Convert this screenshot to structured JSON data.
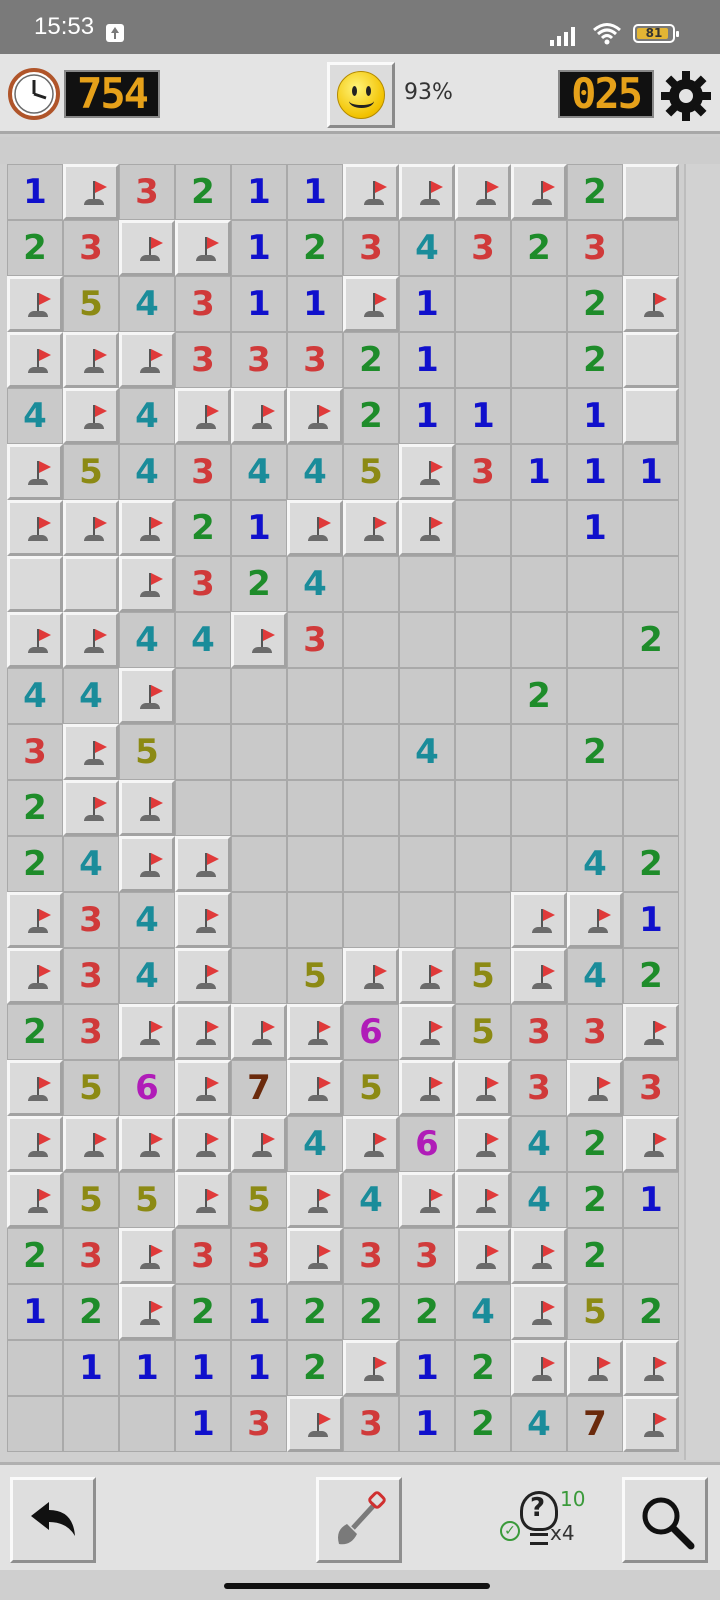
{
  "status_bar": {
    "time": "15:53",
    "battery": "81"
  },
  "header": {
    "timer": "754",
    "percent": "93%",
    "mines_left": "025"
  },
  "legend": {
    "F": "flag",
    "_": "empty opened",
    "R": "raised unopened"
  },
  "colors": {
    "1": "#1010cc",
    "2": "#1e8c2a",
    "3": "#d03a3a",
    "4": "#1a8c9a",
    "5": "#8c8a14",
    "6": "#b01cb8",
    "7": "#6a2a0c",
    "timer_digits": "#e6a11a",
    "flag": "#e03a3a"
  },
  "board": [
    [
      "1",
      "F",
      "3",
      "2",
      "1",
      "1",
      "F",
      "F",
      "F",
      "F",
      "2",
      "R"
    ],
    [
      "2",
      "3",
      "F",
      "F",
      "1",
      "2",
      "3",
      "4",
      "3",
      "2",
      "3",
      "_"
    ],
    [
      "F",
      "5",
      "4",
      "3",
      "1",
      "1",
      "F",
      "1",
      "_",
      "_",
      "2",
      "F"
    ],
    [
      "F",
      "F",
      "F",
      "3",
      "3",
      "3",
      "2",
      "1",
      "_",
      "_",
      "2",
      "R"
    ],
    [
      "4",
      "F",
      "4",
      "F",
      "F",
      "F",
      "2",
      "1",
      "1",
      "_",
      "1",
      "R"
    ],
    [
      "F",
      "5",
      "4",
      "3",
      "4",
      "4",
      "5",
      "F",
      "3",
      "1",
      "1",
      "1"
    ],
    [
      "F",
      "F",
      "F",
      "2",
      "1",
      "F",
      "F",
      "F",
      "_",
      "_",
      "1",
      "_"
    ],
    [
      "R",
      "R",
      "F",
      "3",
      "2",
      "4",
      "_",
      "_",
      "_",
      "_",
      "_",
      "_"
    ],
    [
      "F",
      "F",
      "4",
      "4",
      "F",
      "3",
      "_",
      "_",
      "_",
      "_",
      "_",
      "2"
    ],
    [
      "4",
      "4",
      "F",
      "_",
      "_",
      "_",
      "_",
      "_",
      "_",
      "2",
      "_",
      "_"
    ],
    [
      "3",
      "F",
      "5",
      "_",
      "_",
      "_",
      "_",
      "4",
      "_",
      "_",
      "2",
      "_"
    ],
    [
      "2",
      "F",
      "F",
      "_",
      "_",
      "_",
      "_",
      "_",
      "_",
      "_",
      "_",
      "_"
    ],
    [
      "2",
      "4",
      "F",
      "F",
      "_",
      "_",
      "_",
      "_",
      "_",
      "_",
      "4",
      "2"
    ],
    [
      "F",
      "3",
      "4",
      "F",
      "_",
      "_",
      "_",
      "_",
      "_",
      "F",
      "F",
      "1"
    ],
    [
      "F",
      "3",
      "4",
      "F",
      "_",
      "5",
      "F",
      "F",
      "5",
      "F",
      "4",
      "2"
    ],
    [
      "2",
      "3",
      "F",
      "F",
      "F",
      "F",
      "6",
      "F",
      "5",
      "3",
      "3",
      "F"
    ],
    [
      "F",
      "5",
      "6",
      "F",
      "7",
      "F",
      "5",
      "F",
      "F",
      "3",
      "F",
      "3"
    ],
    [
      "F",
      "F",
      "F",
      "F",
      "F",
      "4",
      "F",
      "6",
      "F",
      "4",
      "2",
      "F"
    ],
    [
      "F",
      "5",
      "5",
      "F",
      "5",
      "F",
      "4",
      "F",
      "F",
      "4",
      "2",
      "1"
    ],
    [
      "2",
      "3",
      "F",
      "3",
      "3",
      "F",
      "3",
      "3",
      "F",
      "F",
      "2",
      "_"
    ],
    [
      "1",
      "2",
      "F",
      "2",
      "1",
      "2",
      "2",
      "2",
      "4",
      "F",
      "5",
      "2"
    ],
    [
      "_",
      "1",
      "1",
      "1",
      "1",
      "2",
      "F",
      "1",
      "2",
      "F",
      "F",
      "F"
    ],
    [
      "_",
      "_",
      "_",
      "1",
      "3",
      "F",
      "3",
      "1",
      "2",
      "4",
      "7",
      "F"
    ]
  ]
}
